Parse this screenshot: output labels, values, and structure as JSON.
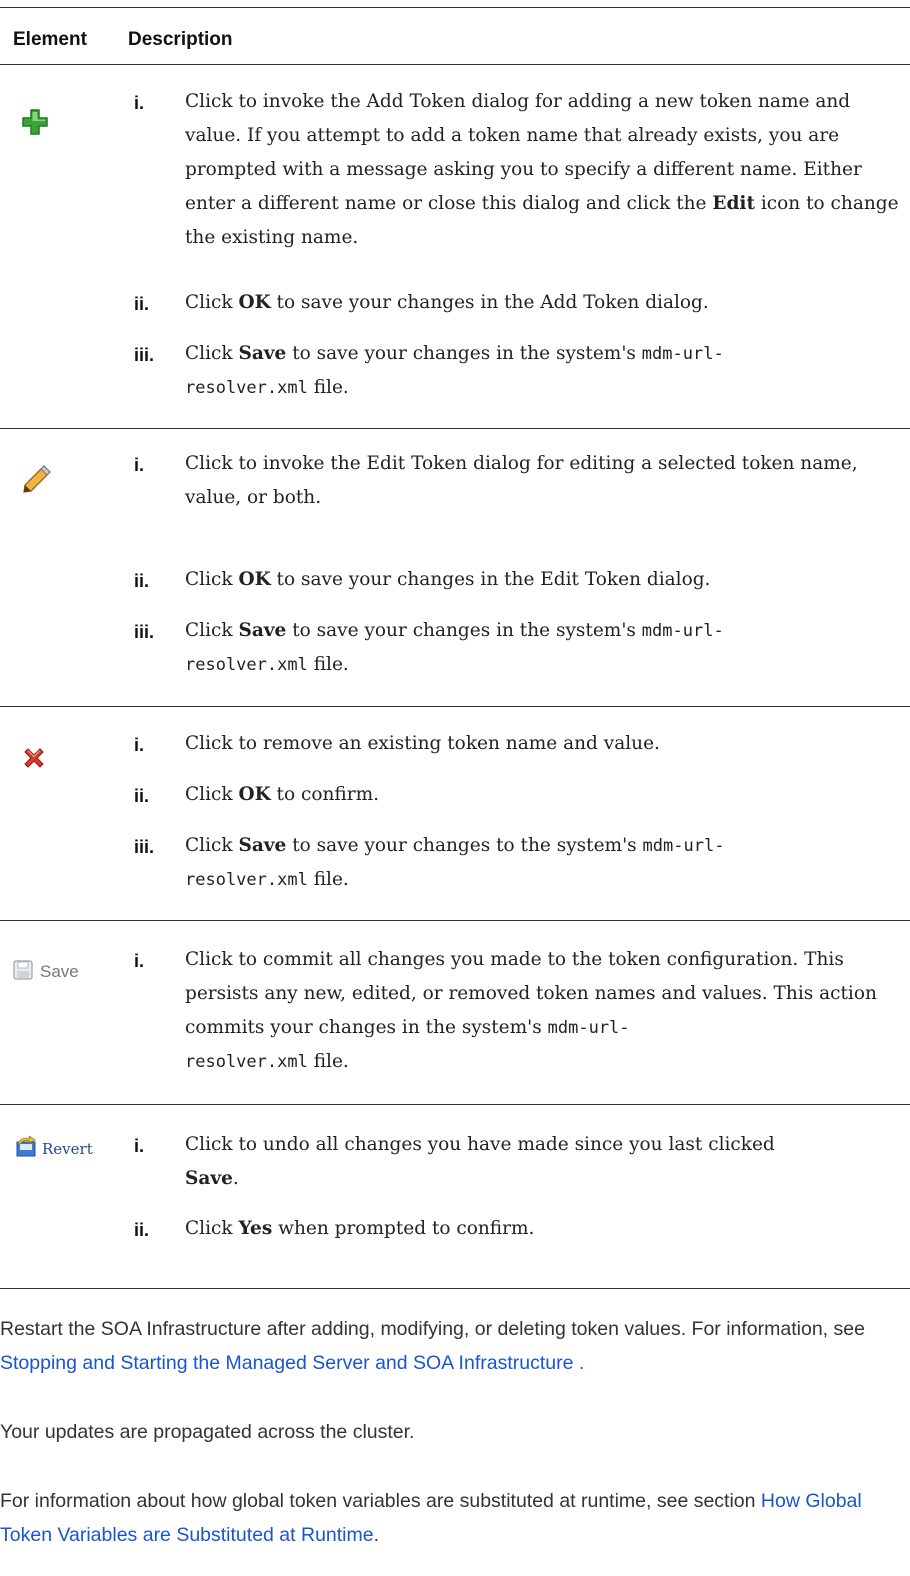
{
  "table": {
    "headers": {
      "element": "Element",
      "description": "Description"
    },
    "rows": [
      {
        "icon": "add-icon",
        "steps": [
          {
            "n": "i.",
            "parts": [
              "Click to invoke the Add Token dialog for adding a new token name and value. If you attempt to add a token name that already exists, you are prompted with a message asking you to specify a different name. Either enter a different name or close this dialog and click the ",
              "Edit",
              " icon to change the existing name."
            ]
          },
          {
            "n": "ii.",
            "parts": [
              "Click ",
              "OK",
              " to save your changes in the Add Token dialog."
            ]
          },
          {
            "n": "iii.",
            "parts": [
              "Click ",
              "Save",
              " to save your changes in the system's ",
              "mdm-url-",
              "resolver.xml",
              " file."
            ]
          }
        ]
      },
      {
        "icon": "edit-pencil-icon",
        "steps": [
          {
            "n": "i.",
            "parts": [
              "Click to invoke the Edit Token dialog for editing a selected token name, value, or both."
            ]
          },
          {
            "n": "ii.",
            "parts": [
              "Click ",
              "OK",
              " to save your changes in the Edit Token dialog."
            ]
          },
          {
            "n": "iii.",
            "parts": [
              "Click ",
              "Save",
              " to save your changes in the system's ",
              "mdm-url-",
              "resolver.xml",
              " file."
            ]
          }
        ]
      },
      {
        "icon": "delete-x-icon",
        "steps": [
          {
            "n": "i.",
            "parts": [
              "Click to remove an existing token name and value."
            ]
          },
          {
            "n": "ii.",
            "parts": [
              "Click ",
              "OK",
              " to confirm."
            ]
          },
          {
            "n": "iii.",
            "parts": [
              "Click ",
              "Save",
              " to save your changes to the system's ",
              "mdm-url-",
              "resolver.xml",
              " file."
            ]
          }
        ]
      },
      {
        "icon": "save-disk-icon",
        "button_label": "Save",
        "steps": [
          {
            "n": "i.",
            "parts": [
              "Click to commit all changes you made to the token configuration. This persists any new, edited, or removed token names and values. This action commits your changes in the system's ",
              "mdm-url-",
              "resolver.xml",
              " file."
            ]
          }
        ]
      },
      {
        "icon": "revert-icon",
        "button_label": "Revert",
        "steps": [
          {
            "n": "i.",
            "parts": [
              "Click to undo all changes you have made since you last clicked ",
              "Save",
              "."
            ]
          },
          {
            "n": "ii.",
            "parts": [
              "Click ",
              "Yes",
              " when prompted to confirm."
            ]
          }
        ]
      }
    ]
  },
  "paragraphs": {
    "restart": {
      "text": "Restart the SOA Infrastructure after adding, modifying, or deleting token values. For information, see ",
      "link": "Stopping and Starting the Managed Server and SOA Infrastructure",
      "after": " ."
    },
    "propagated": "Your updates are propagated across the cluster.",
    "info": {
      "text": "For information about how global token variables are substituted at runtime, see section ",
      "link": "How Global Token Variables are Substituted at Runtime",
      "after": "."
    }
  },
  "colors": {
    "link": "#1a55d0",
    "add_icon": "#3aa535",
    "delete_icon": "#d93a2a",
    "pencil": "#e0a33a"
  }
}
